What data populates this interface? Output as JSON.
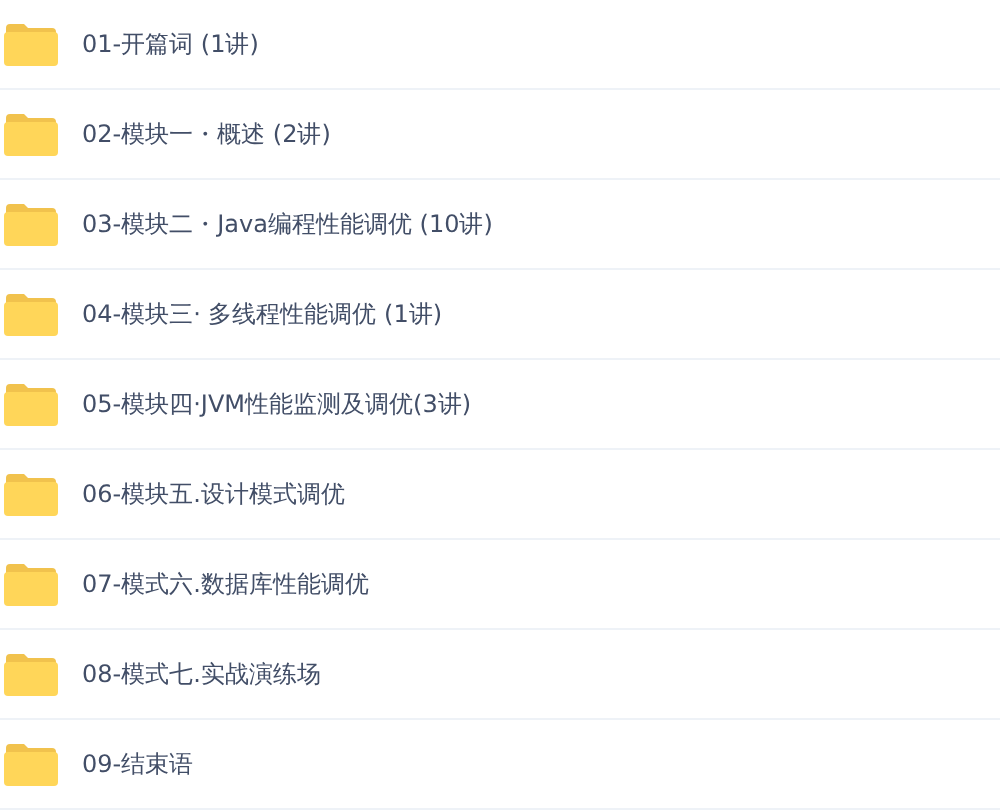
{
  "folders": [
    {
      "name": "01-开篇词 (1讲)"
    },
    {
      "name": "02-模块一・概述 (2讲)"
    },
    {
      "name": "03-模块二・Java编程性能调优 (10讲)"
    },
    {
      "name": "04-模块三· 多线程性能调优 (1讲)"
    },
    {
      "name": "05-模块四·JVM性能监测及调优(3讲)"
    },
    {
      "name": "06-模块五.设计模式调优"
    },
    {
      "name": "07-模式六.数据库性能调优"
    },
    {
      "name": "08-模式七.实战演练场"
    },
    {
      "name": "09-结束语"
    }
  ]
}
